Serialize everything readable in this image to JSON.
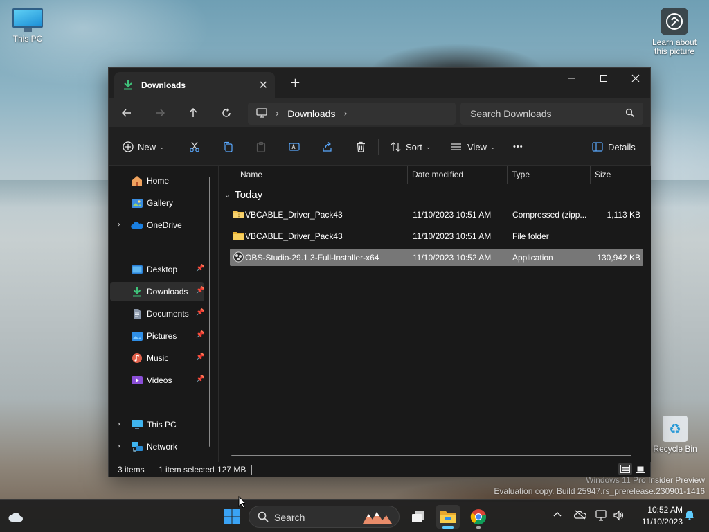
{
  "desktop": {
    "icons": [
      {
        "label": "This PC",
        "icon": "monitor-icon"
      },
      {
        "label": "Learn about this picture",
        "icon": "camera-info-icon"
      },
      {
        "label": "Recycle Bin",
        "icon": "recycle-bin-icon"
      }
    ],
    "watermark": {
      "line1": "Windows 11 Pro Insider Preview",
      "line2": "Evaluation copy. Build 25947.rs_prerelease.230901-1416"
    }
  },
  "window": {
    "tab_title": "Downloads",
    "new_tab_label": "+",
    "breadcrumb": [
      "Downloads"
    ],
    "search_placeholder": "Search Downloads",
    "toolbar": {
      "new_label": "New",
      "sort_label": "Sort",
      "view_label": "View",
      "more_label": "•••",
      "details_label": "Details"
    },
    "sidebar": {
      "top": [
        {
          "label": "Home",
          "icon": "home-icon"
        },
        {
          "label": "Gallery",
          "icon": "gallery-icon"
        },
        {
          "label": "OneDrive",
          "icon": "onedrive-icon",
          "expandable": true
        }
      ],
      "pinned": [
        {
          "label": "Desktop",
          "icon": "desktop-icon",
          "pinned": true
        },
        {
          "label": "Downloads",
          "icon": "downloads-icon",
          "pinned": true,
          "selected": true
        },
        {
          "label": "Documents",
          "icon": "documents-icon",
          "pinned": true
        },
        {
          "label": "Pictures",
          "icon": "pictures-icon",
          "pinned": true
        },
        {
          "label": "Music",
          "icon": "music-icon",
          "pinned": true
        },
        {
          "label": "Videos",
          "icon": "videos-icon",
          "pinned": true
        }
      ],
      "bottom": [
        {
          "label": "This PC",
          "icon": "this-pc-icon",
          "expandable": true
        },
        {
          "label": "Network",
          "icon": "network-icon",
          "expandable": true
        }
      ]
    },
    "columns": [
      "Name",
      "Date modified",
      "Type",
      "Size"
    ],
    "group_title": "Today",
    "files": [
      {
        "name": "VBCABLE_Driver_Pack43",
        "date": "11/10/2023 10:51 AM",
        "type": "Compressed (zipp...",
        "size": "1,113 KB",
        "icon": "zip-folder-icon",
        "selected": false
      },
      {
        "name": "VBCABLE_Driver_Pack43",
        "date": "11/10/2023 10:51 AM",
        "type": "File folder",
        "size": "",
        "icon": "folder-icon",
        "selected": false
      },
      {
        "name": "OBS-Studio-29.1.3-Full-Installer-x64",
        "date": "11/10/2023 10:52 AM",
        "type": "Application",
        "size": "130,942 KB",
        "icon": "obs-icon",
        "selected": true
      }
    ],
    "status": {
      "items_count": "3 items",
      "selection": "1 item selected",
      "selection_size": "127 MB"
    }
  },
  "taskbar": {
    "search_label": "Search",
    "time": "10:52 AM",
    "date": "11/10/2023",
    "accent": "#60cdff"
  }
}
